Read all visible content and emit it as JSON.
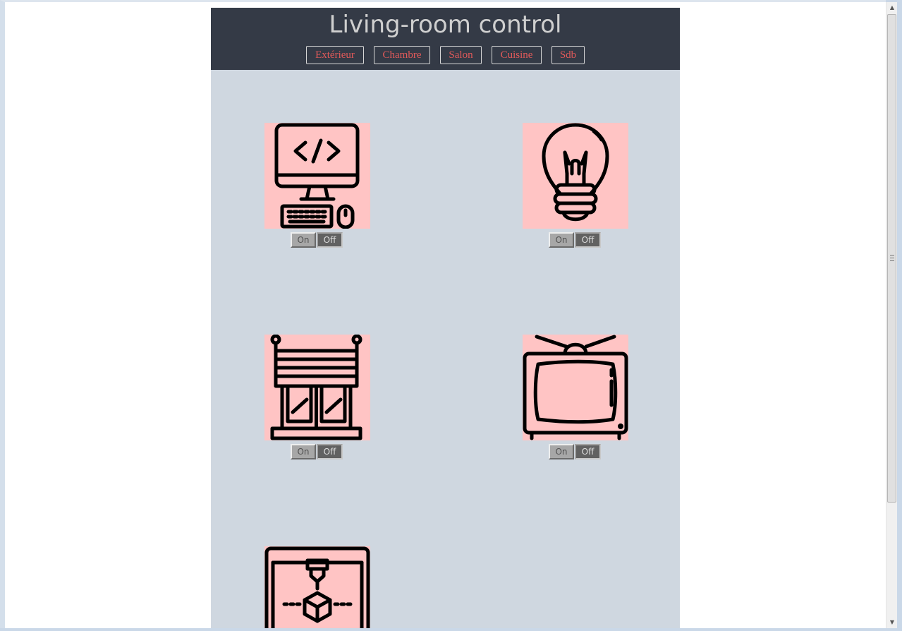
{
  "page": {
    "title": "Living-room control"
  },
  "nav": {
    "items": [
      {
        "label": "Extérieur"
      },
      {
        "label": "Chambre"
      },
      {
        "label": "Salon"
      },
      {
        "label": "Cuisine"
      },
      {
        "label": "Sdb"
      }
    ]
  },
  "devices": [
    {
      "icon": "computer-icon",
      "on_label": "On",
      "off_label": "Off"
    },
    {
      "icon": "light-bulb-icon",
      "on_label": "On",
      "off_label": "Off"
    },
    {
      "icon": "window-blind-icon",
      "on_label": "On",
      "off_label": "Off"
    },
    {
      "icon": "television-icon",
      "on_label": "On",
      "off_label": "Off"
    },
    {
      "icon": "3d-printer-icon"
    }
  ],
  "colors": {
    "header_bg": "#343a46",
    "title_text": "#cfcfcf",
    "nav_text": "#e25a5a",
    "content_bg": "#cfd7e0",
    "tile_bg": "#ffc4c4"
  }
}
